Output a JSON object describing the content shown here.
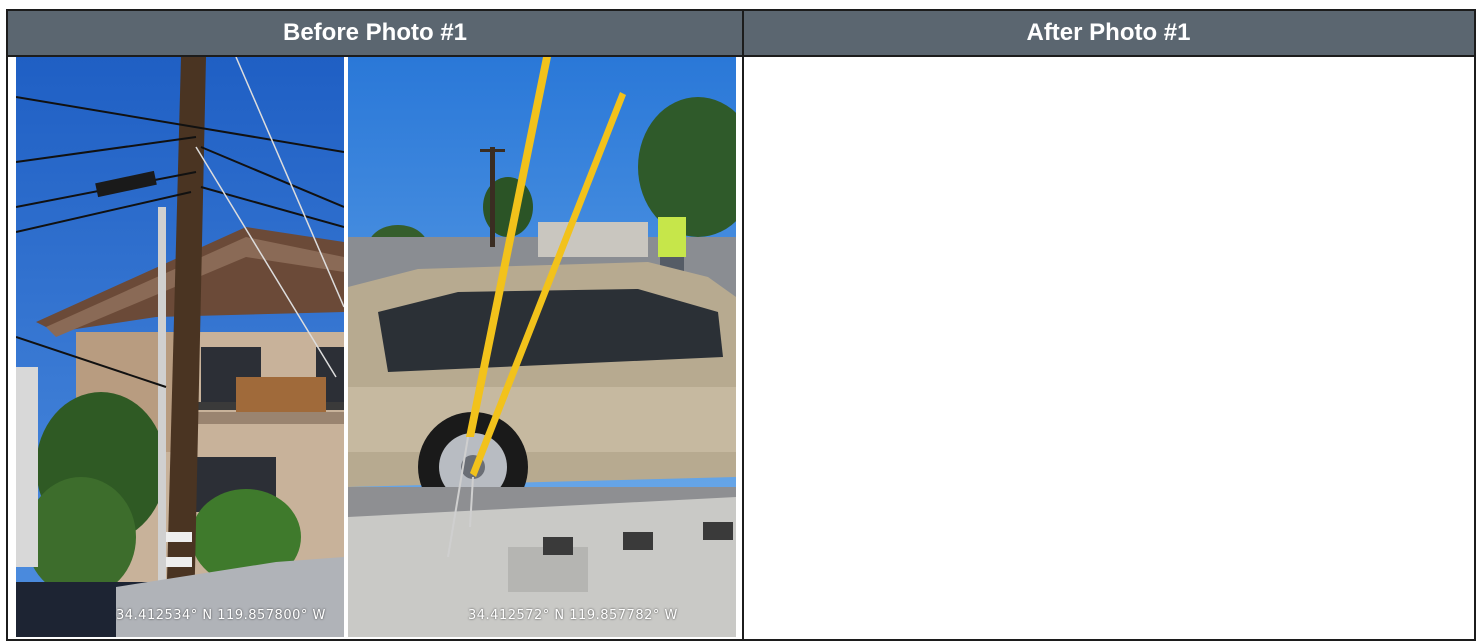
{
  "table": {
    "before_header": "Before Photo #1",
    "after_header": "After Photo #1"
  },
  "photos": {
    "before_left": {
      "gps": "34.412534° N 119.857800° W"
    },
    "before_right": {
      "gps": "34.412572° N 119.857782° W"
    }
  }
}
